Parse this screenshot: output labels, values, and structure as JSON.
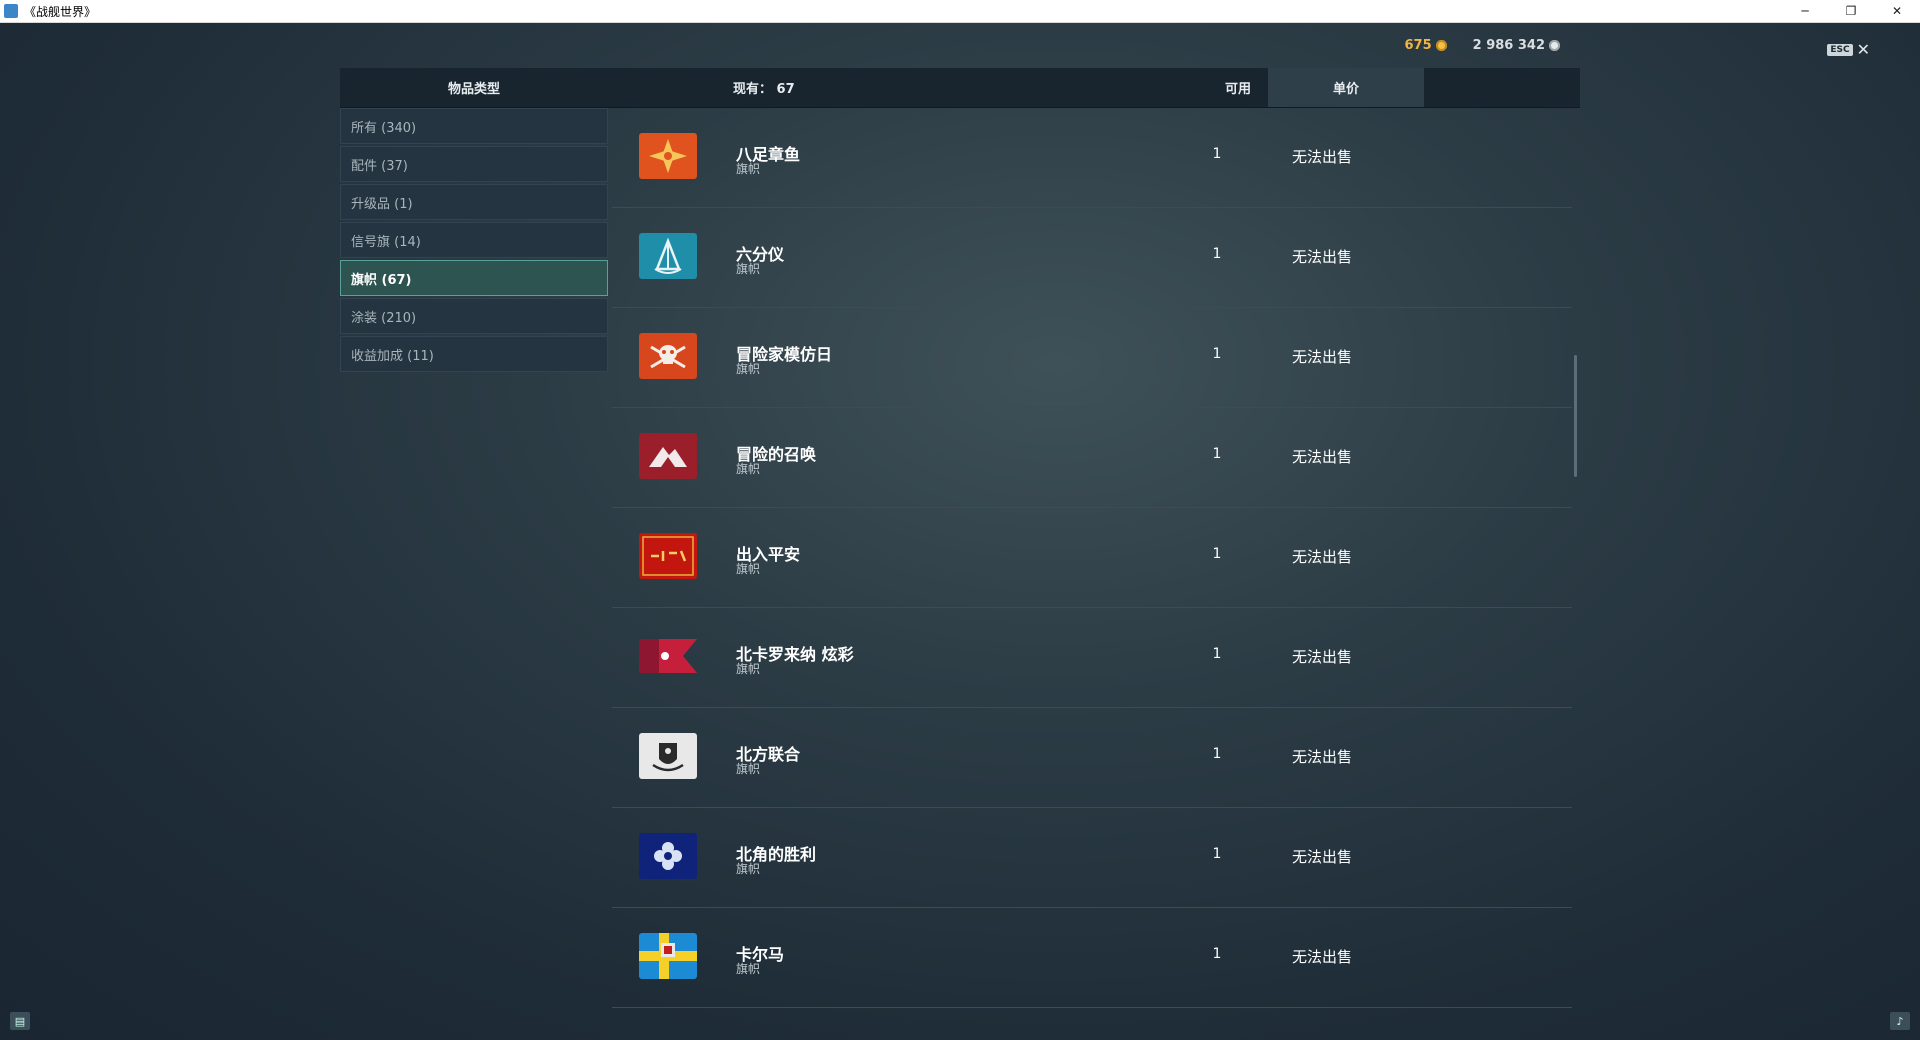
{
  "window": {
    "title": "《战舰世界》",
    "minimize": "─",
    "restore": "❐",
    "close": "✕"
  },
  "currency": {
    "doubloons": "675",
    "credits": "2 986 342"
  },
  "esc": {
    "label": "ESC",
    "close": "✕"
  },
  "header": {
    "type_label": "物品类型",
    "count_label": "现有： 67",
    "available_label": "可用",
    "price_label": "单价"
  },
  "categories": [
    {
      "label": "所有 (340)",
      "active": false
    },
    {
      "label": "配件 (37)",
      "active": false
    },
    {
      "label": "升级品 (1)",
      "active": false
    },
    {
      "label": "信号旗 (14)",
      "active": false
    },
    {
      "label": "旗帜 (67)",
      "active": true
    },
    {
      "label": "涂装 (210)",
      "active": false
    },
    {
      "label": "收益加成 (11)",
      "active": false
    }
  ],
  "items": [
    {
      "name": "八足章鱼",
      "type": "旗帜",
      "available": "1",
      "price": "无法出售",
      "icon": "octopus-flag-icon",
      "color": "#e0531f"
    },
    {
      "name": "六分仪",
      "type": "旗帜",
      "available": "1",
      "price": "无法出售",
      "icon": "sextant-flag-icon",
      "color": "#1f8ea8"
    },
    {
      "name": "冒险家模仿日",
      "type": "旗帜",
      "available": "1",
      "price": "无法出售",
      "icon": "pirate-flag-icon",
      "color": "#d8461e"
    },
    {
      "name": "冒险的召唤",
      "type": "旗帜",
      "available": "1",
      "price": "无法出售",
      "icon": "mountain-flag-icon",
      "color": "#9b1f2a"
    },
    {
      "name": "出入平安",
      "type": "旗帜",
      "available": "1",
      "price": "无法出售",
      "icon": "calligraphy-flag-icon",
      "color": "#c3160f"
    },
    {
      "name": "北卡罗来纳 炫彩",
      "type": "旗帜",
      "available": "1",
      "price": "无法出售",
      "icon": "north-carolina-flag-icon",
      "color": "#c51f3c"
    },
    {
      "name": "北方联合",
      "type": "旗帜",
      "available": "1",
      "price": "无法出售",
      "icon": "crest-flag-icon",
      "color": "#e8e8e8"
    },
    {
      "name": "北角的胜利",
      "type": "旗帜",
      "available": "1",
      "price": "无法出售",
      "icon": "north-cape-flag-icon",
      "color": "#10237a"
    },
    {
      "name": "卡尔马",
      "type": "旗帜",
      "available": "1",
      "price": "无法出售",
      "icon": "kalmar-flag-icon",
      "color": "#1c8bd4"
    }
  ]
}
